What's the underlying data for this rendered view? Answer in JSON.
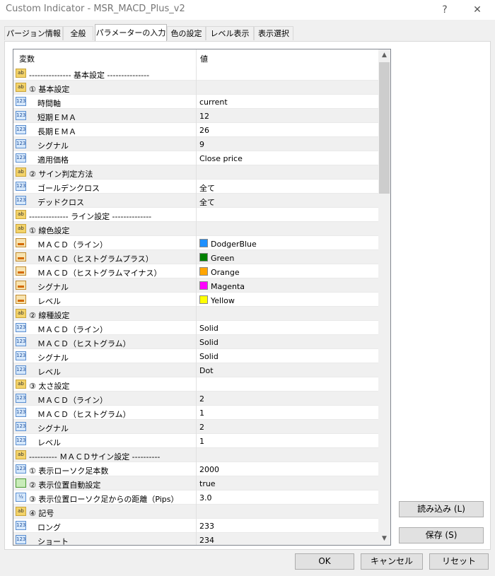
{
  "window": {
    "title": "Custom Indicator - MSR_MACD_Plus_v2",
    "help_glyph": "?",
    "close_glyph": "✕"
  },
  "tabs": [
    {
      "label": "パージョン情報"
    },
    {
      "label": "全般"
    },
    {
      "label": "パラメーターの入力"
    },
    {
      "label": "色の設定"
    },
    {
      "label": "レベル表示"
    },
    {
      "label": "表示選択"
    }
  ],
  "grid": {
    "header": {
      "variable": "変数",
      "value": "値"
    },
    "rows": [
      {
        "icon": "ab",
        "indent": false,
        "name": "--------------- 基本設定 ---------------",
        "value": ""
      },
      {
        "icon": "ab",
        "indent": false,
        "name": "① 基本設定",
        "value": ""
      },
      {
        "icon": "123",
        "indent": true,
        "name": "時間軸",
        "value": "current"
      },
      {
        "icon": "123",
        "indent": true,
        "name": "短期ＥＭＡ",
        "value": "12"
      },
      {
        "icon": "123",
        "indent": true,
        "name": "長期ＥＭＡ",
        "value": "26"
      },
      {
        "icon": "123",
        "indent": true,
        "name": "シグナル",
        "value": "9"
      },
      {
        "icon": "123",
        "indent": true,
        "name": "適用価格",
        "value": "Close price"
      },
      {
        "icon": "ab",
        "indent": false,
        "name": "② サイン判定方法",
        "value": ""
      },
      {
        "icon": "123",
        "indent": true,
        "name": "ゴールデンクロス",
        "value": "全て"
      },
      {
        "icon": "123",
        "indent": true,
        "name": "デッドクロス",
        "value": "全て"
      },
      {
        "icon": "ab",
        "indent": false,
        "name": "-------------- ライン設定 --------------",
        "value": ""
      },
      {
        "icon": "ab",
        "indent": false,
        "name": "① 線色設定",
        "value": ""
      },
      {
        "icon": "color",
        "indent": true,
        "name": "ＭＡＣＤ（ライン）",
        "value": "DodgerBlue",
        "swatch": "#1e90ff"
      },
      {
        "icon": "color",
        "indent": true,
        "name": "ＭＡＣＤ（ヒストグラムプラス）",
        "value": "Green",
        "swatch": "#008000"
      },
      {
        "icon": "color",
        "indent": true,
        "name": "ＭＡＣＤ（ヒストグラムマイナス）",
        "value": "Orange",
        "swatch": "#ffa500"
      },
      {
        "icon": "color",
        "indent": true,
        "name": "シグナル",
        "value": "Magenta",
        "swatch": "#ff00ff"
      },
      {
        "icon": "color",
        "indent": true,
        "name": "レベル",
        "value": "Yellow",
        "swatch": "#ffff00"
      },
      {
        "icon": "ab",
        "indent": false,
        "name": "② 線種設定",
        "value": ""
      },
      {
        "icon": "123",
        "indent": true,
        "name": "ＭＡＣＤ（ライン）",
        "value": "Solid"
      },
      {
        "icon": "123",
        "indent": true,
        "name": "ＭＡＣＤ（ヒストグラム）",
        "value": "Solid"
      },
      {
        "icon": "123",
        "indent": true,
        "name": "シグナル",
        "value": "Solid"
      },
      {
        "icon": "123",
        "indent": true,
        "name": "レベル",
        "value": "Dot"
      },
      {
        "icon": "ab",
        "indent": false,
        "name": "③ 太さ設定",
        "value": ""
      },
      {
        "icon": "123",
        "indent": true,
        "name": "ＭＡＣＤ（ライン）",
        "value": "2"
      },
      {
        "icon": "123",
        "indent": true,
        "name": "ＭＡＣＤ（ヒストグラム）",
        "value": "1"
      },
      {
        "icon": "123",
        "indent": true,
        "name": "シグナル",
        "value": "2"
      },
      {
        "icon": "123",
        "indent": true,
        "name": "レベル",
        "value": "1"
      },
      {
        "icon": "ab",
        "indent": false,
        "name": "---------- ＭＡＣＤサイン設定 ----------",
        "value": ""
      },
      {
        "icon": "123",
        "indent": false,
        "name": "① 表示ローソク足本数",
        "value": "2000"
      },
      {
        "icon": "bool",
        "indent": false,
        "name": "② 表示位置自動設定",
        "value": "true"
      },
      {
        "icon": "double",
        "indent": false,
        "name": "③ 表示位置ローソク足からの距離（Pips）",
        "value": "3.0"
      },
      {
        "icon": "ab",
        "indent": false,
        "name": "④ 記号",
        "value": ""
      },
      {
        "icon": "123",
        "indent": true,
        "name": "ロング",
        "value": "233"
      },
      {
        "icon": "123",
        "indent": true,
        "name": "ショート",
        "value": "234"
      }
    ]
  },
  "icon_text": {
    "ab": "ab",
    "123": "123",
    "bool": "",
    "double": "½"
  },
  "scrollbar": {
    "up_glyph": "▲",
    "down_glyph": "▼"
  },
  "buttons": {
    "load": "読み込み (L)",
    "save": "保存 (S)",
    "ok": "OK",
    "cancel": "キャンセル",
    "reset": "リセット"
  }
}
